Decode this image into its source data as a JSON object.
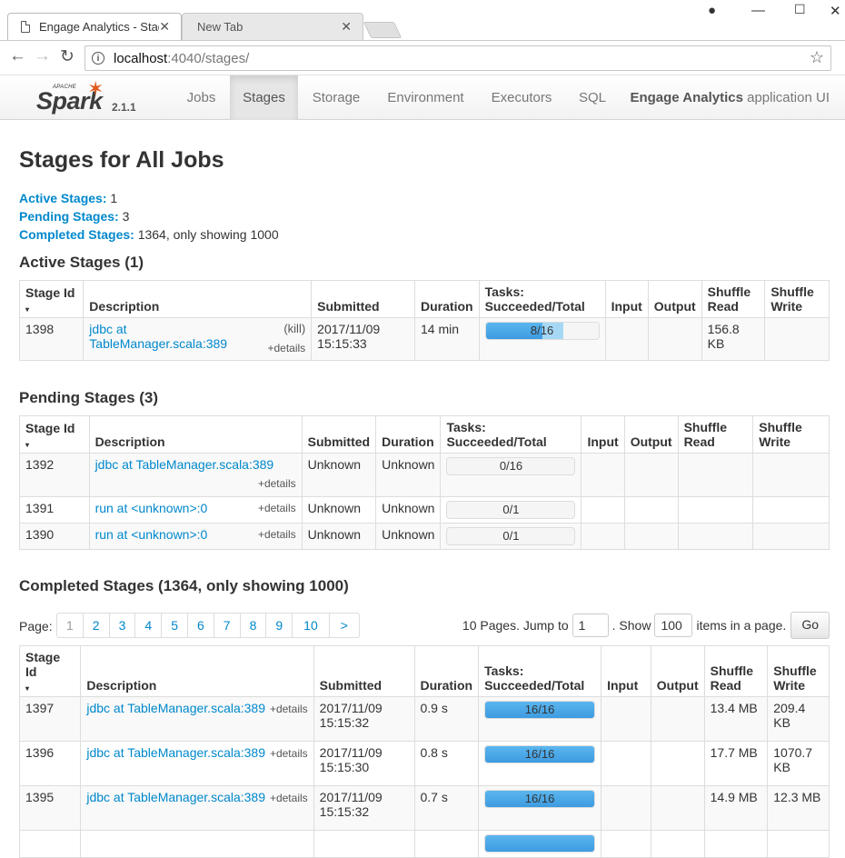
{
  "browser": {
    "tabs": [
      {
        "label": "Engage Analytics - Stage",
        "active": true
      },
      {
        "label": "New Tab",
        "active": false
      }
    ],
    "url_host": "localhost",
    "url_rest": ":4040/stages/"
  },
  "navbar": {
    "brand_apache": "APACHE",
    "brand_name": "Spark",
    "version": "2.1.1",
    "links": [
      "Jobs",
      "Stages",
      "Storage",
      "Environment",
      "Executors",
      "SQL"
    ],
    "active_link": "Stages",
    "app_name_bold": "Engage Analytics",
    "app_name_rest": " application UI"
  },
  "page": {
    "title": "Stages for All Jobs",
    "summary": [
      {
        "label": "Active Stages:",
        "value": "1"
      },
      {
        "label": "Pending Stages:",
        "value": "3"
      },
      {
        "label": "Completed Stages:",
        "value": "1364, only showing 1000"
      }
    ]
  },
  "columns": {
    "stage_id": "Stage Id",
    "sort_arrow": "▾",
    "description": "Description",
    "submitted": "Submitted",
    "duration": "Duration",
    "tasks_line1": "Tasks:",
    "tasks_line2": "Succeeded/Total",
    "input": "Input",
    "output": "Output",
    "shuffle_read_1": "Shuffle",
    "shuffle_read_2": "Read",
    "shuffle_write_1": "Shuffle",
    "shuffle_write_2": "Write"
  },
  "active": {
    "heading": "Active Stages (1)",
    "rows": [
      {
        "id": "1398",
        "desc_1": "jdbc at",
        "desc_2": "TableManager.scala:389",
        "kill": "(kill)",
        "details": "+details",
        "submitted_1": "2017/11/09",
        "submitted_2": "15:15:33",
        "duration": "14 min",
        "tasks": "8/16",
        "succeeded": 8,
        "running": 3,
        "total": 16,
        "input": "",
        "output": "",
        "shuffle_read": "156.8 KB",
        "shuffle_write": ""
      }
    ]
  },
  "pending": {
    "heading": "Pending Stages (3)",
    "rows": [
      {
        "id": "1392",
        "desc": "jdbc at TableManager.scala:389",
        "details": "+details",
        "submitted": "Unknown",
        "duration": "Unknown",
        "tasks": "0/16"
      },
      {
        "id": "1391",
        "desc": "run at <unknown>:0",
        "details": "+details",
        "submitted": "Unknown",
        "duration": "Unknown",
        "tasks": "0/1"
      },
      {
        "id": "1390",
        "desc": "run at <unknown>:0",
        "details": "+details",
        "submitted": "Unknown",
        "duration": "Unknown",
        "tasks": "0/1"
      }
    ]
  },
  "completed": {
    "heading": "Completed Stages (1364, only showing 1000)",
    "pager": {
      "label": "Page:",
      "pages": [
        "1",
        "2",
        "3",
        "4",
        "5",
        "6",
        "7",
        "8",
        "9",
        "10",
        ">"
      ],
      "pages_text": "10 Pages. Jump to",
      "jump_value": "1",
      "show_text": ". Show",
      "show_value": "100",
      "items_text": "items in a page.",
      "go": "Go"
    },
    "rows": [
      {
        "id": "1397",
        "desc": "jdbc at TableManager.scala:389",
        "details": "+details",
        "submitted_1": "2017/11/09",
        "submitted_2": "15:15:32",
        "duration": "0.9 s",
        "tasks": "16/16",
        "shuffle_read": "13.4 MB",
        "shuffle_write_1": "209.4 KB",
        "shuffle_write_2": ""
      },
      {
        "id": "1396",
        "desc": "jdbc at TableManager.scala:389",
        "details": "+details",
        "submitted_1": "2017/11/09",
        "submitted_2": "15:15:30",
        "duration": "0.8 s",
        "tasks": "16/16",
        "shuffle_read": "17.7 MB",
        "shuffle_write_1": "1070.7",
        "shuffle_write_2": "KB"
      },
      {
        "id": "1395",
        "desc": "jdbc at TableManager.scala:389",
        "details": "+details",
        "submitted_1": "2017/11/09",
        "submitted_2": "15:15:32",
        "duration": "0.7 s",
        "tasks": "16/16",
        "shuffle_read": "14.9 MB",
        "shuffle_write_1": "12.3 MB",
        "shuffle_write_2": ""
      }
    ]
  }
}
